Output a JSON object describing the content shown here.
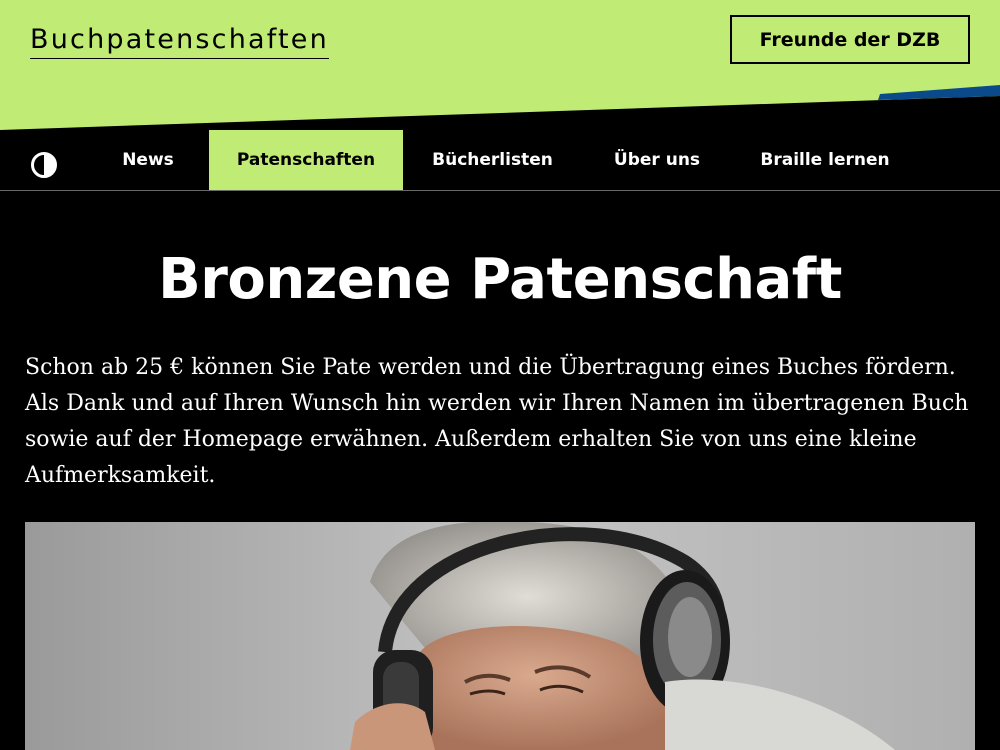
{
  "header": {
    "logo": "Buchpatenschaften",
    "friends_button": "Freunde der DZB",
    "bg_color": "#c0eb75"
  },
  "nav": {
    "contrast_icon": "contrast-icon",
    "items": [
      {
        "label": "News",
        "active": false
      },
      {
        "label": "Patenschaften",
        "active": true
      },
      {
        "label": "Bücherlisten",
        "active": false
      },
      {
        "label": "Über uns",
        "active": false
      },
      {
        "label": "Braille lernen",
        "active": false
      }
    ],
    "active_color": "#c0eb75"
  },
  "main": {
    "title": "Bronzene Patenschaft",
    "intro": "Schon ab 25 € können Sie Pate werden und die Übertragung eines Buches fördern. Als Dank und auf Ihren Wunsch hin werden wir Ihren Namen im übertragenen Buch sowie auf der Homepage erwähnen. Außerdem erhalten Sie von uns eine kleine Aufmerksamkeit.",
    "image": "photo of man with headphones listening to audiobook"
  }
}
